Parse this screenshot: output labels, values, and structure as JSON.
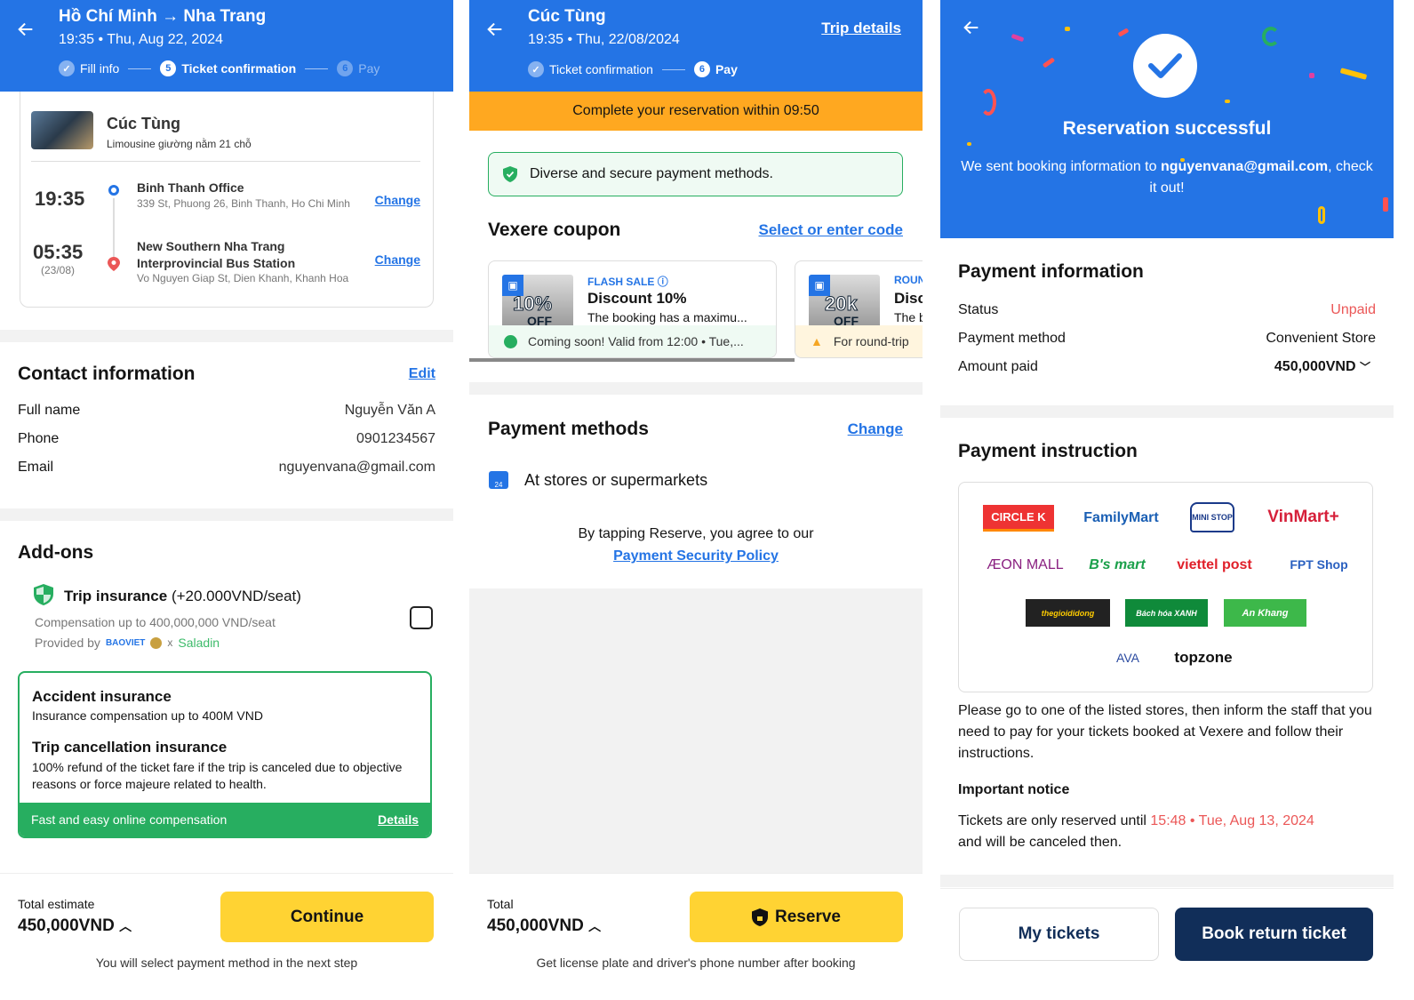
{
  "screen1": {
    "header": {
      "title": "Hồ Chí Minh → Nha Trang",
      "subtitle": "19:35 • Thu, Aug 22, 2024"
    },
    "steps": [
      {
        "label": "Fill info",
        "state": "done"
      },
      {
        "num": "5",
        "label": "Ticket confirmation",
        "state": "current"
      },
      {
        "num": "6",
        "label": "Pay",
        "state": "upcoming"
      }
    ],
    "operator": {
      "name": "Cúc Tùng",
      "vehicle": "Limousine giường nằm 21 chỗ"
    },
    "pickup": {
      "time": "19:35",
      "name": "Binh Thanh Office",
      "address": "339 St, Phuong 26, Binh Thanh, Ho Chi Minh",
      "change": "Change"
    },
    "dropoff": {
      "time": "05:35",
      "date": "(23/08)",
      "name": "New Southern Nha Trang Interprovincial Bus Station",
      "address": "Vo Nguyen Giap St, Dien Khanh, Khanh Hoa",
      "change": "Change"
    },
    "contact": {
      "title": "Contact information",
      "edit": "Edit",
      "rows": [
        {
          "label": "Full name",
          "value": "Nguyễn Văn A"
        },
        {
          "label": "Phone",
          "value": "0901234567"
        },
        {
          "label": "Email",
          "value": "nguyenvana@gmail.com"
        }
      ]
    },
    "addons": {
      "title": "Add-ons",
      "insurance_title": "Trip insurance",
      "insurance_price": "(+20.000VND/seat)",
      "compensation": "Compensation up to 400,000,000 VND/seat",
      "provided_by": "Provided by",
      "provider1": "BAOVIET",
      "x": "x",
      "provider2": "Saladin",
      "checked": false,
      "accident_title": "Accident insurance",
      "accident_desc": "Insurance compensation up to 400M VND",
      "cancel_title": "Trip cancellation insurance",
      "cancel_desc": "100% refund of the ticket fare if the trip is canceled due to objective reasons or force majeure related to health.",
      "banner": "Fast and easy online compensation",
      "details": "Details"
    },
    "footer": {
      "total_label": "Total estimate",
      "total": "450,000VND",
      "button": "Continue",
      "note": "You will select payment method in the next step"
    }
  },
  "screen2": {
    "header": {
      "title": "Cúc Tùng",
      "subtitle": "19:35 • Thu, 22/08/2024",
      "trip_details": "Trip details"
    },
    "steps": [
      {
        "label": "Ticket confirmation",
        "state": "done"
      },
      {
        "num": "6",
        "label": "Pay",
        "state": "current"
      }
    ],
    "timer": "Complete your reservation within 09:50",
    "secure": "Diverse and secure payment methods.",
    "coupon": {
      "title": "Vexere coupon",
      "select": "Select or enter code",
      "items": [
        {
          "badge": "10%",
          "off": "OFF",
          "tag": "FLASH SALE",
          "title": "Discount 10%",
          "desc": "The booking has a maximu...",
          "footer": "Coming soon! Valid from 12:00 • Tue,..."
        },
        {
          "badge": "20k",
          "off": "OFF",
          "tag": "ROUN",
          "title": "Disc",
          "desc": "The b",
          "footer": "For round-trip"
        }
      ]
    },
    "payment": {
      "title": "Payment methods",
      "change": "Change",
      "method": "At stores or supermarkets"
    },
    "agree": "By tapping Reserve, you agree to our",
    "policy": "Payment Security Policy",
    "footer": {
      "total_label": "Total",
      "total": "450,000VND",
      "button": "Reserve",
      "note": "Get license plate and driver's phone number after booking"
    }
  },
  "screen3": {
    "title": "Reservation successful",
    "msg_prefix": "We sent booking information to",
    "email": "nguyenvana@gmail.com",
    "msg_suffix": ", check it out!",
    "payment_info": {
      "title": "Payment information",
      "rows": [
        {
          "label": "Status",
          "value": "Unpaid"
        },
        {
          "label": "Payment method",
          "value": "Convenient Store"
        },
        {
          "label": "Amount paid",
          "value": "450,000VND"
        }
      ]
    },
    "instruction": {
      "title": "Payment instruction",
      "stores": [
        "CIRCLE K",
        "FamilyMart",
        "MINI STOP",
        "VinMart+",
        "ÆON MALL",
        "B's mart",
        "viettel post",
        "FPT Shop",
        "thegioididong",
        "Bách hóa XANH",
        "An Khang",
        "AVA",
        "topzone"
      ],
      "text": "Please go to one of the listed stores, then inform the staff that you need to pay for your tickets booked at Vexere and follow their instructions.",
      "notice_title": "Important notice",
      "notice_prefix": "Tickets are only reserved until",
      "notice_time": "15:48 • Tue, Aug 13, 2024",
      "notice_suffix": "and will be canceled then."
    },
    "buttons": {
      "my_tickets": "My tickets",
      "book_return": "Book return ticket"
    }
  },
  "colors": {
    "primary": "#2474e5",
    "yellow": "#ffd333",
    "orange": "#ffa820",
    "green": "#27ae60",
    "red": "#eb5757",
    "navy": "#112e59"
  }
}
